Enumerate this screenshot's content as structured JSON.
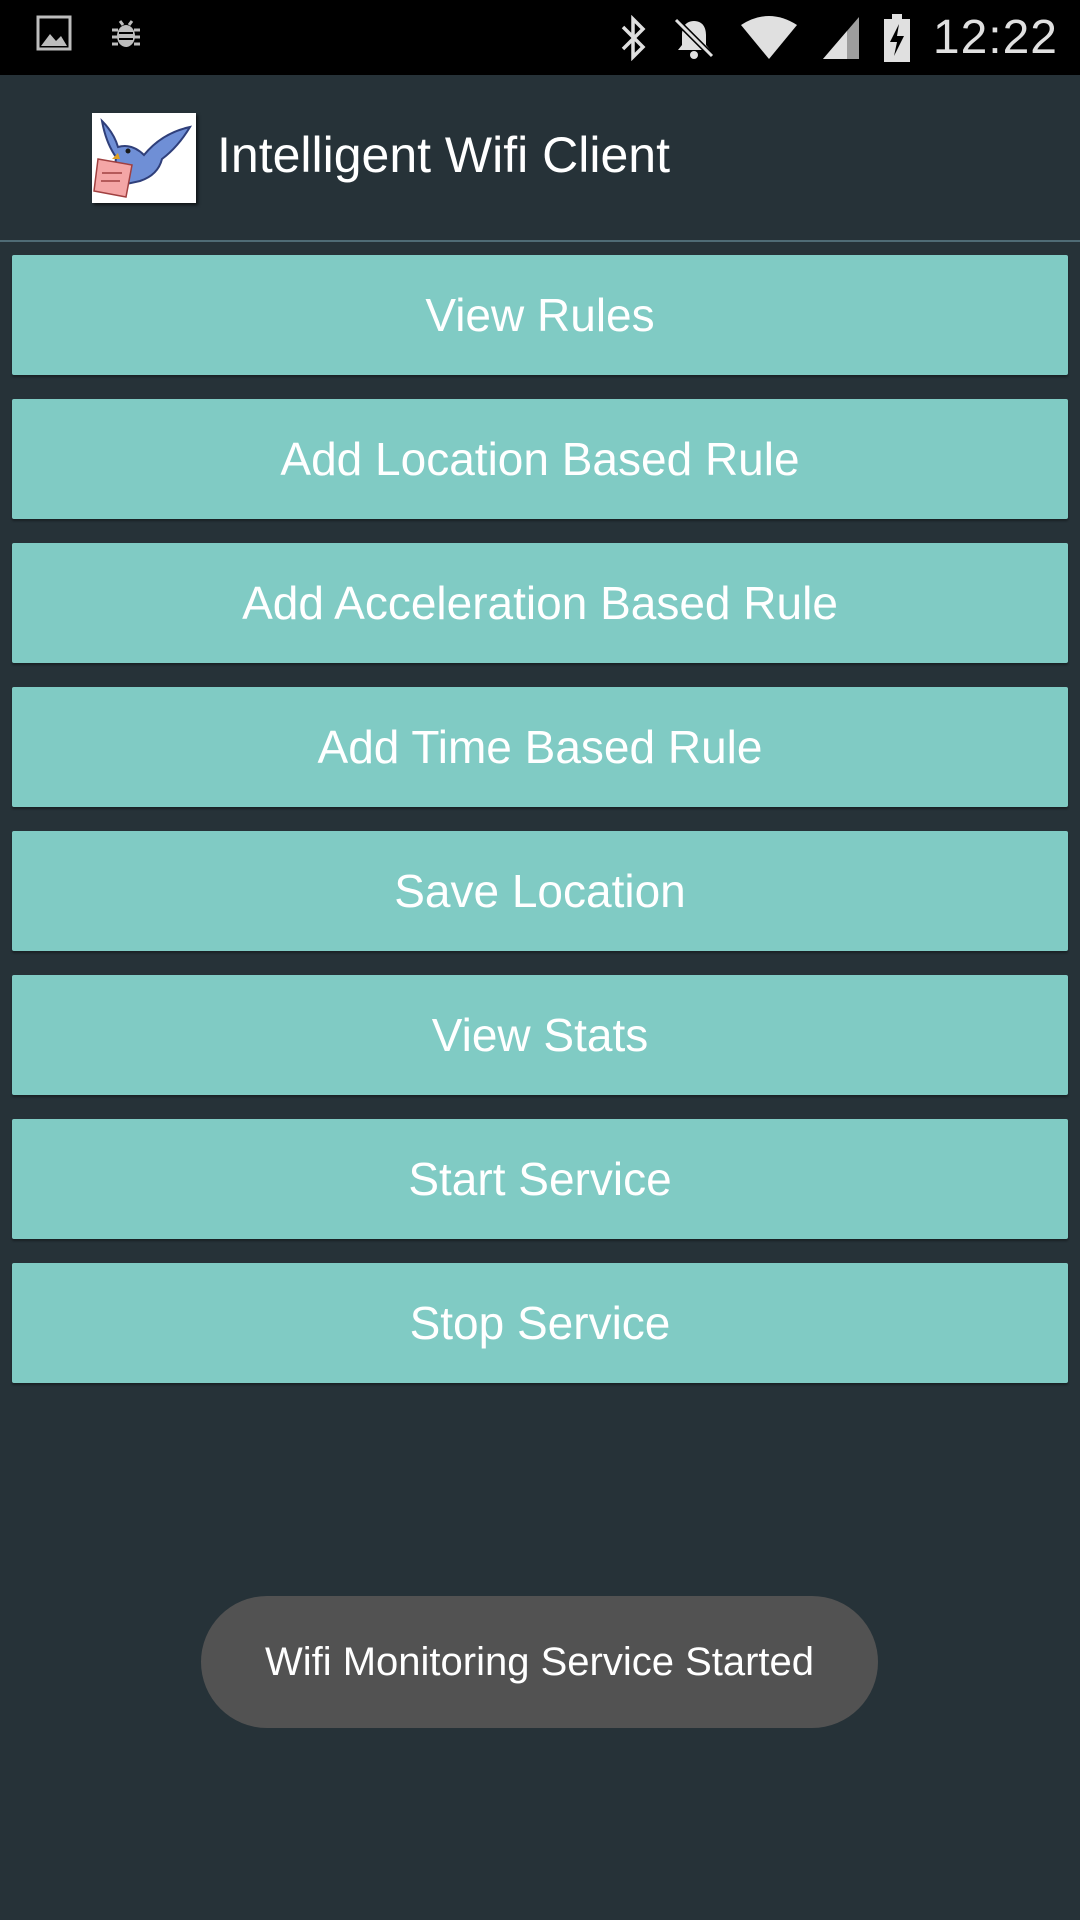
{
  "status_bar": {
    "time": "12:22",
    "left_icons": [
      "image-notification-icon",
      "bug-notification-icon"
    ],
    "right_icons": [
      "bluetooth-icon",
      "notifications-off-icon",
      "wifi-signal-icon",
      "cell-signal-icon",
      "battery-charging-icon"
    ]
  },
  "app_bar": {
    "title": "Intelligent Wifi Client",
    "logo_icon": "bluebird-letter-logo-icon"
  },
  "buttons": {
    "view_rules": "View Rules",
    "add_location_rule": "Add Location Based Rule",
    "add_acceleration_rule": "Add Acceleration Based Rule",
    "add_time_rule": "Add Time Based Rule",
    "save_location": "Save Location",
    "view_stats": "View Stats",
    "start_service": "Start Service",
    "stop_service": "Stop Service"
  },
  "toast": {
    "message": "Wifi Monitoring Service Started"
  },
  "colors": {
    "background": "#263238",
    "button": "#80cbc4",
    "toast": "#525252",
    "status_bar": "#000000"
  }
}
